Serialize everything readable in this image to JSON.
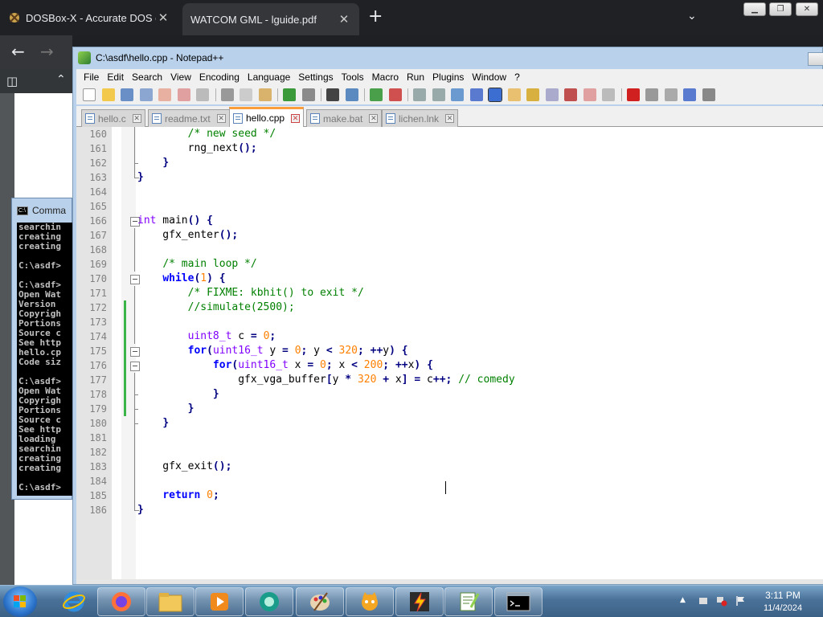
{
  "browser": {
    "tabs": [
      {
        "label": "DOSBox-X - Accurate DOS emu",
        "close": "✕"
      },
      {
        "label": "WATCOM GML - lguide.pdf",
        "close": "✕"
      }
    ],
    "new_tab": "+",
    "tab_menu": "⌄"
  },
  "cmd": {
    "title": "Comma",
    "lines": "searchin\ncreating\ncreating\n\nC:\\asdf>\n\nC:\\asdf>\nOpen Wat\nVersion \nCopyrigh\nPortions\nSource c\nSee http\nhello.cp\nCode siz\n\nC:\\asdf>\nOpen Wat\nCopyrigh\nPortions\nSource c\nSee http\nloading \nsearchin\ncreating\ncreating\n\nC:\\asdf>"
  },
  "npp": {
    "title": "C:\\asdf\\hello.cpp - Notepad++",
    "menu": [
      "File",
      "Edit",
      "Search",
      "View",
      "Encoding",
      "Language",
      "Settings",
      "Tools",
      "Macro",
      "Run",
      "Plugins",
      "Window",
      "?"
    ],
    "tabs": [
      {
        "label": "hello.c",
        "active": false,
        "dirty": false
      },
      {
        "label": "readme.txt",
        "active": false,
        "dirty": false
      },
      {
        "label": "hello.cpp",
        "active": true,
        "dirty": false
      },
      {
        "label": "make.bat",
        "active": false,
        "dirty": false
      },
      {
        "label": "lichen.lnk",
        "active": false,
        "dirty": false
      }
    ],
    "close_glyph": "✕"
  },
  "code": [
    {
      "n": "160",
      "fold": "vline",
      "chg": false,
      "t": [
        [
          "        ",
          ""
        ],
        [
          "/* new seed */",
          "c"
        ]
      ]
    },
    {
      "n": "161",
      "fold": "vline",
      "chg": false,
      "t": [
        [
          "        rng_next",
          ""
        ],
        [
          "();",
          "o"
        ]
      ]
    },
    {
      "n": "162",
      "fold": "tick",
      "chg": false,
      "t": [
        [
          "    ",
          ""
        ],
        [
          "}",
          "o"
        ]
      ]
    },
    {
      "n": "163",
      "fold": "end",
      "chg": false,
      "t": [
        [
          "}",
          "o"
        ]
      ]
    },
    {
      "n": "164",
      "fold": "",
      "chg": false,
      "t": []
    },
    {
      "n": "165",
      "fold": "",
      "chg": false,
      "t": []
    },
    {
      "n": "166",
      "fold": "box",
      "chg": false,
      "t": [
        [
          "int",
          "t"
        ],
        [
          " main",
          ""
        ],
        [
          "()",
          "o"
        ],
        [
          " ",
          ""
        ],
        [
          "{",
          "o"
        ]
      ]
    },
    {
      "n": "167",
      "fold": "vline",
      "chg": false,
      "t": [
        [
          "    gfx_enter",
          ""
        ],
        [
          "();",
          "o"
        ]
      ]
    },
    {
      "n": "168",
      "fold": "vline",
      "chg": false,
      "t": []
    },
    {
      "n": "169",
      "fold": "vline",
      "chg": false,
      "t": [
        [
          "    ",
          ""
        ],
        [
          "/* main loop */",
          "c"
        ]
      ]
    },
    {
      "n": "170",
      "fold": "box",
      "chg": false,
      "t": [
        [
          "    ",
          ""
        ],
        [
          "while",
          "k"
        ],
        [
          "(",
          "o"
        ],
        [
          "1",
          "n"
        ],
        [
          ")",
          "o"
        ],
        [
          " ",
          ""
        ],
        [
          "{",
          "o"
        ]
      ]
    },
    {
      "n": "171",
      "fold": "vline",
      "chg": false,
      "t": [
        [
          "        ",
          ""
        ],
        [
          "/* FIXME: kbhit() to exit */",
          "c"
        ]
      ]
    },
    {
      "n": "172",
      "fold": "vline",
      "chg": true,
      "t": [
        [
          "        ",
          ""
        ],
        [
          "//simulate(2500);",
          "c"
        ]
      ]
    },
    {
      "n": "173",
      "fold": "vline",
      "chg": true,
      "t": []
    },
    {
      "n": "174",
      "fold": "vline",
      "chg": true,
      "t": [
        [
          "        ",
          ""
        ],
        [
          "uint8_t",
          "t"
        ],
        [
          " c ",
          ""
        ],
        [
          "=",
          "o"
        ],
        [
          " ",
          ""
        ],
        [
          "0",
          "n"
        ],
        [
          ";",
          "o"
        ]
      ]
    },
    {
      "n": "175",
      "fold": "box",
      "chg": true,
      "t": [
        [
          "        ",
          ""
        ],
        [
          "for",
          "k"
        ],
        [
          "(",
          "o"
        ],
        [
          "uint16_t",
          "t"
        ],
        [
          " y ",
          ""
        ],
        [
          "=",
          "o"
        ],
        [
          " ",
          ""
        ],
        [
          "0",
          "n"
        ],
        [
          ";",
          "o"
        ],
        [
          " y ",
          ""
        ],
        [
          "<",
          "o"
        ],
        [
          " ",
          ""
        ],
        [
          "320",
          "n"
        ],
        [
          ";",
          "o"
        ],
        [
          " ",
          ""
        ],
        [
          "++",
          "o"
        ],
        [
          "y",
          ""
        ],
        [
          ")",
          "o"
        ],
        [
          " ",
          ""
        ],
        [
          "{",
          "o"
        ]
      ]
    },
    {
      "n": "176",
      "fold": "box",
      "chg": true,
      "t": [
        [
          "            ",
          ""
        ],
        [
          "for",
          "k"
        ],
        [
          "(",
          "o"
        ],
        [
          "uint16_t",
          "t"
        ],
        [
          " x ",
          ""
        ],
        [
          "=",
          "o"
        ],
        [
          " ",
          ""
        ],
        [
          "0",
          "n"
        ],
        [
          ";",
          "o"
        ],
        [
          " x ",
          ""
        ],
        [
          "<",
          "o"
        ],
        [
          " ",
          ""
        ],
        [
          "200",
          "n"
        ],
        [
          ";",
          "o"
        ],
        [
          " ",
          ""
        ],
        [
          "++",
          "o"
        ],
        [
          "x",
          ""
        ],
        [
          ")",
          "o"
        ],
        [
          " ",
          ""
        ],
        [
          "{",
          "o"
        ]
      ]
    },
    {
      "n": "177",
      "fold": "vline",
      "chg": true,
      "t": [
        [
          "                gfx_vga_buffer",
          ""
        ],
        [
          "[",
          "o"
        ],
        [
          "y ",
          ""
        ],
        [
          "*",
          "o"
        ],
        [
          " ",
          ""
        ],
        [
          "320",
          "n"
        ],
        [
          " ",
          ""
        ],
        [
          "+",
          "o"
        ],
        [
          " x",
          ""
        ],
        [
          "]",
          "o"
        ],
        [
          " ",
          ""
        ],
        [
          "=",
          "o"
        ],
        [
          " c",
          ""
        ],
        [
          "++;",
          "o"
        ],
        [
          " ",
          ""
        ],
        [
          "// comedy",
          "c"
        ]
      ]
    },
    {
      "n": "178",
      "fold": "tick",
      "chg": true,
      "t": [
        [
          "            ",
          ""
        ],
        [
          "}",
          "o"
        ]
      ]
    },
    {
      "n": "179",
      "fold": "tick",
      "chg": true,
      "t": [
        [
          "        ",
          ""
        ],
        [
          "}",
          "o"
        ]
      ]
    },
    {
      "n": "180",
      "fold": "tick",
      "chg": false,
      "t": [
        [
          "    ",
          ""
        ],
        [
          "}",
          "o"
        ]
      ]
    },
    {
      "n": "181",
      "fold": "vline",
      "chg": false,
      "t": []
    },
    {
      "n": "182",
      "fold": "vline",
      "chg": false,
      "t": []
    },
    {
      "n": "183",
      "fold": "vline",
      "chg": false,
      "t": [
        [
          "    gfx_exit",
          ""
        ],
        [
          "();",
          "o"
        ]
      ]
    },
    {
      "n": "184",
      "fold": "vline",
      "chg": false,
      "t": []
    },
    {
      "n": "185",
      "fold": "vline",
      "chg": false,
      "t": [
        [
          "    ",
          ""
        ],
        [
          "return",
          "k"
        ],
        [
          " ",
          ""
        ],
        [
          "0",
          "n"
        ],
        [
          ";",
          "o"
        ]
      ]
    },
    {
      "n": "186",
      "fold": "end",
      "chg": false,
      "t": [
        [
          "}",
          "o"
        ]
      ]
    }
  ],
  "taskbar": {
    "time": "3:11 PM",
    "date": "11/4/2024",
    "apps": [
      "internet-explorer",
      "firefox",
      "file-explorer",
      "media-player",
      "unknown-app",
      "paint",
      "scratch",
      "winamp",
      "notepad-plus-plus",
      "command-prompt"
    ]
  }
}
